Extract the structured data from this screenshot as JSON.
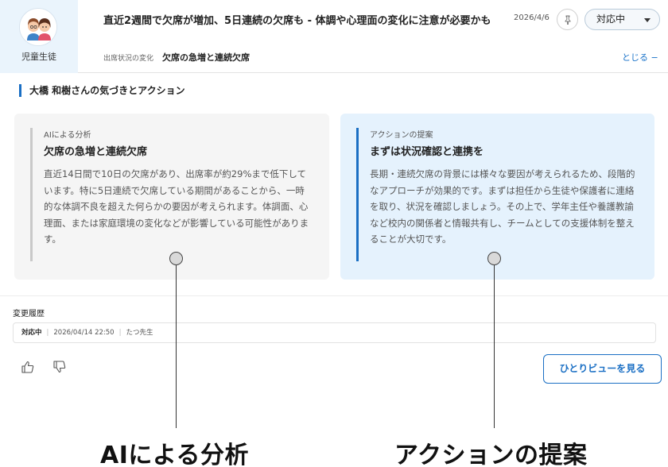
{
  "header": {
    "side_label": "児童生徒",
    "title": "直近2週間で欠席が増加、5日連続の欠席も - 体調や心理面の変化に注意が必要かも",
    "date": "2026/4/6",
    "status_value": "対応中",
    "sub_category": "出席状況の変化",
    "sub_value": "欠席の急増と連続欠席",
    "collapse_label": "とじる −"
  },
  "section": {
    "heading": "大橋 和樹さんの気づきとアクション"
  },
  "analysis_card": {
    "category": "AIによる分析",
    "title": "欠席の急増と連続欠席",
    "body": "直近14日間で10日の欠席があり、出席率が約29%まで低下しています。特に5日連続で欠席している期間があることから、一時的な体調不良を超えた何らかの要因が考えられます。体調面、心理面、または家庭環境の変化などが影響している可能性があります。"
  },
  "action_card": {
    "category": "アクションの提案",
    "title": "まずは状況確認と連携を",
    "body": "長期・連続欠席の背景には様々な要因が考えられるため、段階的なアプローチが効果的です。まずは担任から生徒や保護者に連絡を取り、状況を確認しましょう。その上で、学年主任や養護教諭など校内の関係者と情報共有し、チームとしての支援体制を整えることが大切です。"
  },
  "history": {
    "label": "変更履歴",
    "entries": [
      {
        "status": "対応中",
        "datetime": "2026/04/14 22:50",
        "author": "たつ先生"
      }
    ]
  },
  "feedback": {
    "like_icon": "thumbs-up-icon",
    "dislike_icon": "thumbs-down-icon"
  },
  "view_button_label": "ひとりビューを見る",
  "callouts": {
    "left": "AIによる分析",
    "right": "アクションの提案"
  },
  "colors": {
    "accent": "#1a6fc4",
    "side_panel": "#eaf4fc",
    "analysis_bg": "#f5f5f5",
    "action_bg": "#e5f2fd"
  }
}
